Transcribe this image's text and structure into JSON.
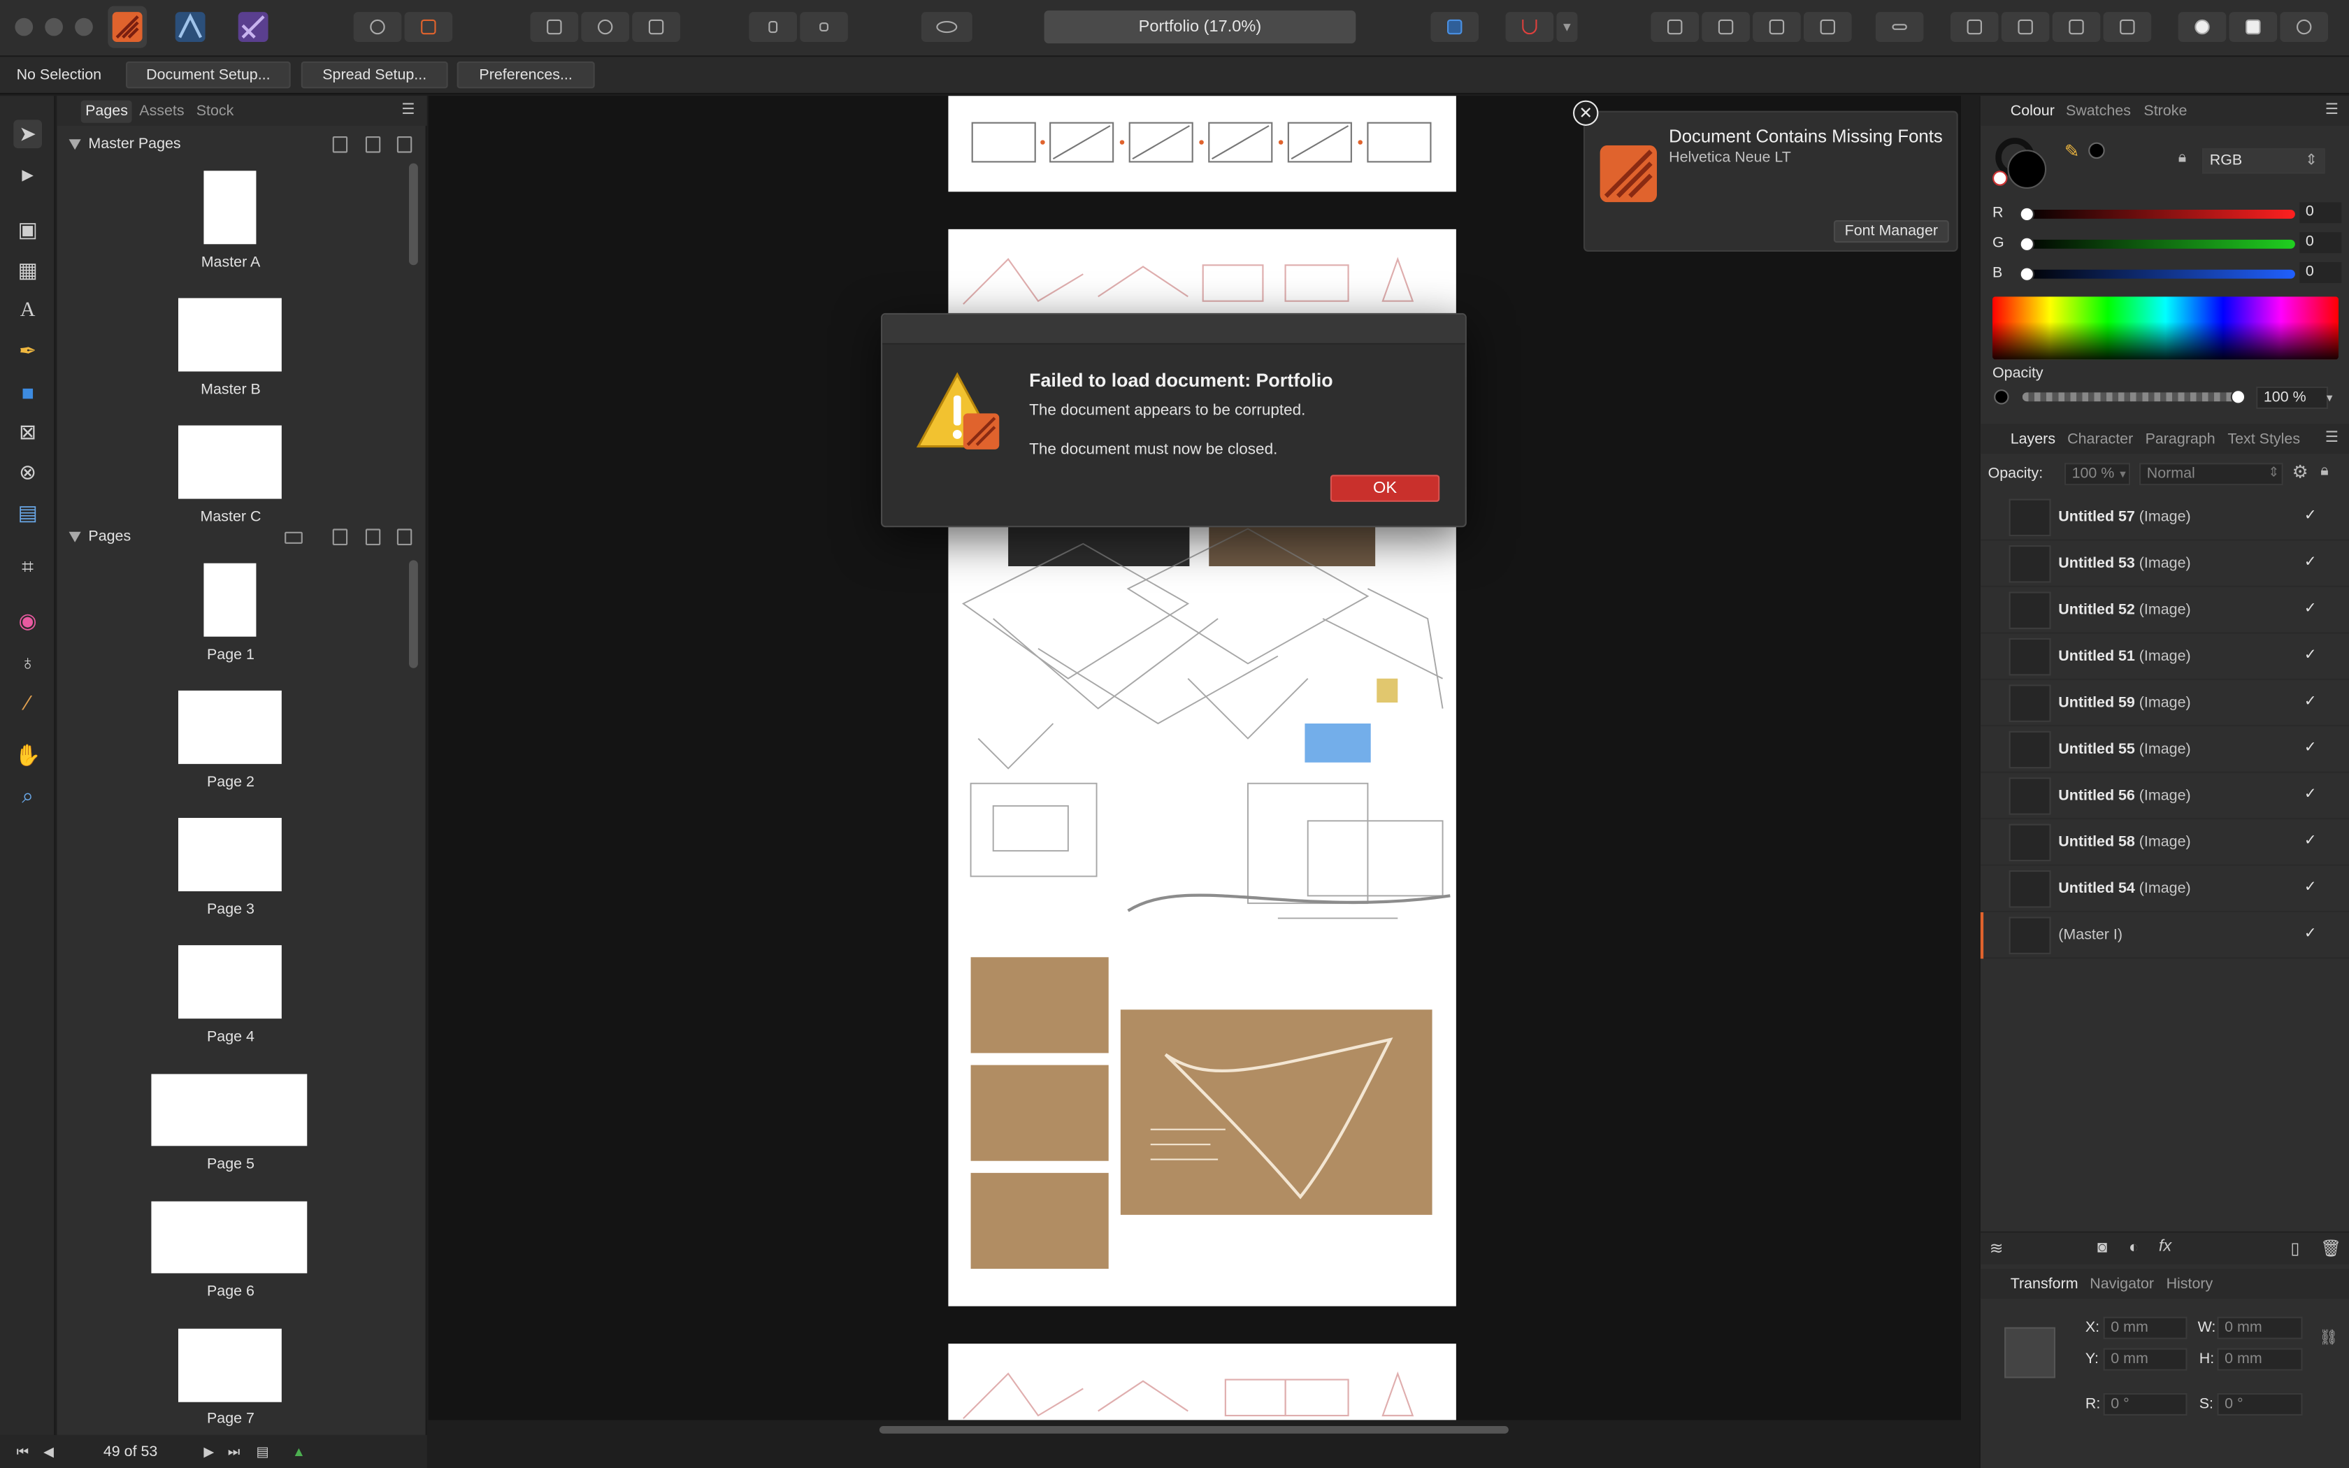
{
  "window": {
    "doc_title": "Portfolio (17.0%)",
    "personas": [
      "publisher-persona-icon",
      "designer-persona-icon",
      "photo-persona-icon"
    ]
  },
  "context_toolbar": {
    "selection": "No Selection",
    "document_setup": "Document Setup...",
    "spread_setup": "Spread Setup...",
    "preferences": "Preferences..."
  },
  "pages_panel": {
    "tabs": [
      "Pages",
      "Assets",
      "Stock"
    ],
    "master_section": "Master Pages",
    "masters": [
      "Master A",
      "Master B",
      "Master C"
    ],
    "pages_section": "Pages",
    "pages": [
      "Page 1",
      "Page 2",
      "Page 3",
      "Page 4",
      "Page 5",
      "Page 6",
      "Page 7"
    ],
    "page_count": "49 of 53"
  },
  "notification": {
    "title": "Document Contains Missing Fonts",
    "font": "Helvetica Neue LT",
    "button": "Font Manager"
  },
  "dialog": {
    "title": "Failed to load document: Portfolio",
    "line1": "The document appears to be corrupted.",
    "line2": "The document must now be closed.",
    "ok": "OK"
  },
  "colour_panel": {
    "tabs": [
      "Colour",
      "Swatches",
      "Stroke"
    ],
    "model": "RGB",
    "r_label": "R",
    "r": "0",
    "g_label": "G",
    "g": "0",
    "b_label": "B",
    "b": "0",
    "opacity_label": "Opacity",
    "opacity": "100 %"
  },
  "layers_panel": {
    "tabs": [
      "Layers",
      "Character",
      "Paragraph",
      "Text Styles"
    ],
    "opacity_label": "Opacity:",
    "opacity": "100 %",
    "blend": "Normal",
    "layers": [
      {
        "name": "Untitled 57",
        "kind": "(Image)"
      },
      {
        "name": "Untitled 53",
        "kind": "(Image)"
      },
      {
        "name": "Untitled 52",
        "kind": "(Image)"
      },
      {
        "name": "Untitled 51",
        "kind": "(Image)"
      },
      {
        "name": "Untitled 59",
        "kind": "(Image)"
      },
      {
        "name": "Untitled 55",
        "kind": "(Image)"
      },
      {
        "name": "Untitled 56",
        "kind": "(Image)"
      },
      {
        "name": "Untitled 58",
        "kind": "(Image)"
      },
      {
        "name": "Untitled 54",
        "kind": "(Image)"
      }
    ],
    "master_layer": "(Master I)",
    "check": "✓"
  },
  "transform_panel": {
    "tabs": [
      "Transform",
      "Navigator",
      "History"
    ],
    "x_label": "X:",
    "x": "0 mm",
    "y_label": "Y:",
    "y": "0 mm",
    "w_label": "W:",
    "w": "0 mm",
    "h_label": "H:",
    "h": "0 mm",
    "r_label": "R:",
    "r": "0 °",
    "s_label": "S:",
    "s": "0 °"
  },
  "colors": {
    "accent_orange": "#e0632d",
    "ok_red": "#c9302c",
    "panel_bg": "#2f2f2f",
    "canvas_bg": "#141414"
  }
}
